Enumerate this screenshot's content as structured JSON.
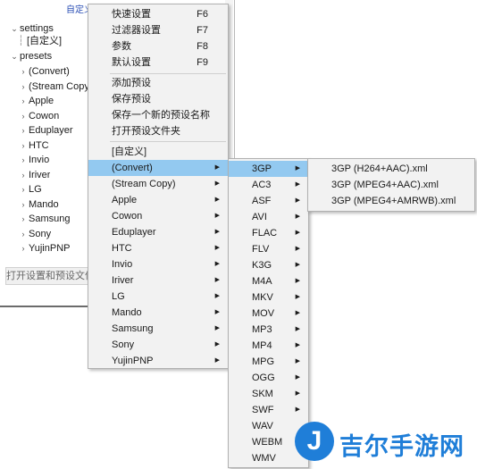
{
  "window": {
    "top_link": "自定义",
    "tree": {
      "settings_label": "settings",
      "settings_child": "[自定义]",
      "presets_label": "presets",
      "preset_items": [
        "(Convert)",
        "(Stream Copy)",
        "Apple",
        "Cowon",
        "Eduplayer",
        "HTC",
        "Invio",
        "Iriver",
        "LG",
        "Mando",
        "Samsung",
        "Sony",
        "YujinPNP"
      ]
    },
    "open_button": "打开设置和预设文件夹"
  },
  "context_menu": {
    "group1": [
      {
        "label": "快速设置",
        "shortcut": "F6"
      },
      {
        "label": "过滤器设置",
        "shortcut": "F7"
      },
      {
        "label": "参数",
        "shortcut": "F8"
      },
      {
        "label": "默认设置",
        "shortcut": "F9"
      }
    ],
    "group2": [
      "添加预设",
      "保存预设",
      "保存一个新的预设名称",
      "打开预设文件夹"
    ],
    "group3": [
      "[自定义]",
      "(Convert)",
      "(Stream Copy)",
      "Apple",
      "Cowon",
      "Eduplayer",
      "HTC",
      "Invio",
      "Iriver",
      "LG",
      "Mando",
      "Samsung",
      "Sony",
      "YujinPNP"
    ],
    "selected": "(Convert)"
  },
  "formats_menu": {
    "items": [
      "3GP",
      "AC3",
      "ASF",
      "AVI",
      "FLAC",
      "FLV",
      "K3G",
      "M4A",
      "MKV",
      "MOV",
      "MP3",
      "MP4",
      "MPG",
      "OGG",
      "SKM",
      "SWF",
      "WAV",
      "WEBM",
      "WMV"
    ],
    "has_submenu_count": 16,
    "selected": "3GP"
  },
  "presets_menu": {
    "items": [
      "3GP (H264+AAC).xml",
      "3GP (MPEG4+AAC).xml",
      "3GP (MPEG4+AMRWB).xml"
    ]
  },
  "watermark": {
    "logo_glyph": "J",
    "text": "吉尔手游网",
    "color": "#1f7ed8"
  },
  "colors": {
    "menu_bg": "#f2f2f2",
    "highlight": "#93c9f0"
  }
}
